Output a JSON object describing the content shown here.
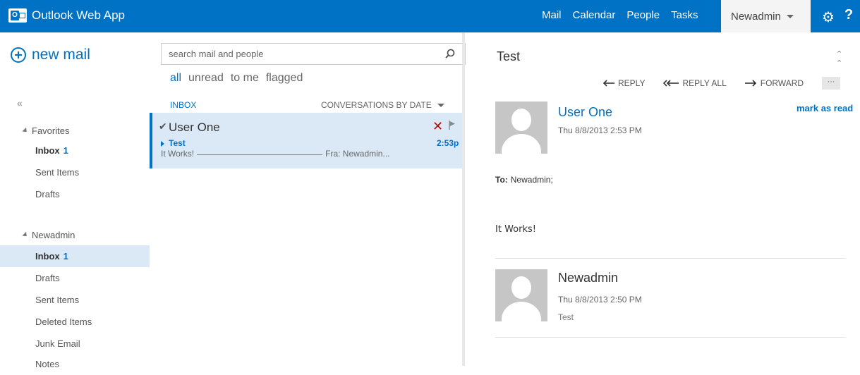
{
  "app": {
    "name": "Outlook Web App"
  },
  "topnav": {
    "items": [
      "Mail",
      "Calendar",
      "People",
      "Tasks"
    ],
    "user": "Newadmin"
  },
  "left": {
    "new_mail": "new mail",
    "collapse": "«",
    "favorites_header": "Favorites",
    "favorites": [
      {
        "name": "Inbox",
        "count": "1"
      },
      {
        "name": "Sent Items",
        "count": ""
      },
      {
        "name": "Drafts",
        "count": ""
      }
    ],
    "account_header": "Newadmin",
    "folders": [
      {
        "name": "Inbox",
        "count": "1"
      },
      {
        "name": "Drafts",
        "count": ""
      },
      {
        "name": "Sent Items",
        "count": ""
      },
      {
        "name": "Deleted Items",
        "count": ""
      },
      {
        "name": "Junk Email",
        "count": ""
      },
      {
        "name": "Notes",
        "count": ""
      }
    ]
  },
  "search": {
    "placeholder": "search mail and people"
  },
  "filters": [
    "all",
    "unread",
    "to me",
    "flagged"
  ],
  "list": {
    "folder": "INBOX",
    "sort": "CONVERSATIONS BY DATE",
    "messages": [
      {
        "from": "User One",
        "subject": "Test",
        "preview_start": "It Works!",
        "preview_end": "Fra: Newadmin...",
        "time": "2:53p"
      }
    ]
  },
  "reading": {
    "title": "Test",
    "actions": [
      "REPLY",
      "REPLY ALL",
      "FORWARD"
    ],
    "more": "···",
    "mark_as_read": "mark as read",
    "message1": {
      "sender": "User One",
      "date": "Thu 8/8/2013 2:53 PM",
      "to_label": "To:",
      "to": "Newadmin;",
      "body": "It Works!"
    },
    "message2": {
      "sender": "Newadmin",
      "date": "Thu 8/8/2013 2:50 PM",
      "preview": "Test"
    }
  },
  "colors": {
    "accent": "#0072c6",
    "selection": "#dbe9f7",
    "delete": "#cc0000"
  }
}
